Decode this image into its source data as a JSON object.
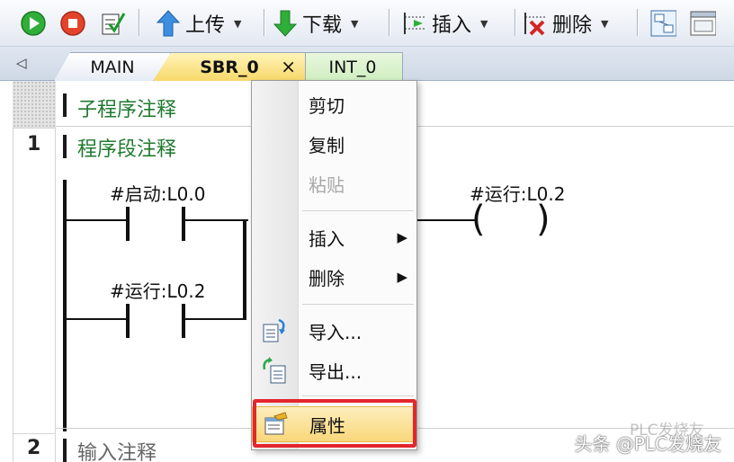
{
  "toolbar": {
    "upload_label": "上传",
    "download_label": "下载",
    "insert_label": "插入",
    "delete_label": "删除"
  },
  "tabs": [
    {
      "label": "MAIN"
    },
    {
      "label": "SBR_0",
      "active": true,
      "close": "×"
    },
    {
      "label": "INT_0"
    }
  ],
  "editor": {
    "subroutine_comment": "子程序注释",
    "networks": [
      {
        "number": "1",
        "comment": "程序段注释"
      },
      {
        "number": "2",
        "comment": "输入注释"
      }
    ],
    "contacts": [
      {
        "operand": "#启动:L0.0"
      },
      {
        "operand": "#运行:L0.2"
      }
    ],
    "coil": {
      "operand": "#运行:L0.2"
    }
  },
  "context_menu": {
    "items": [
      {
        "label": "剪切",
        "enabled": true
      },
      {
        "label": "复制",
        "enabled": true
      },
      {
        "label": "粘贴",
        "enabled": false
      },
      {
        "label": "插入",
        "submenu": true
      },
      {
        "label": "删除",
        "submenu": true
      },
      {
        "label": "导入...",
        "icon": "import-icon"
      },
      {
        "label": "导出...",
        "icon": "export-icon"
      },
      {
        "label": "属性",
        "icon": "properties-icon",
        "highlighted": true
      }
    ]
  },
  "watermark": {
    "text": "头条 @PLC发烧友",
    "faded": "PLC发烧友"
  },
  "colors": {
    "comment_green": "#1f7a2e",
    "highlight_frame": "#e4262c",
    "active_tab": "#f7d86a"
  }
}
